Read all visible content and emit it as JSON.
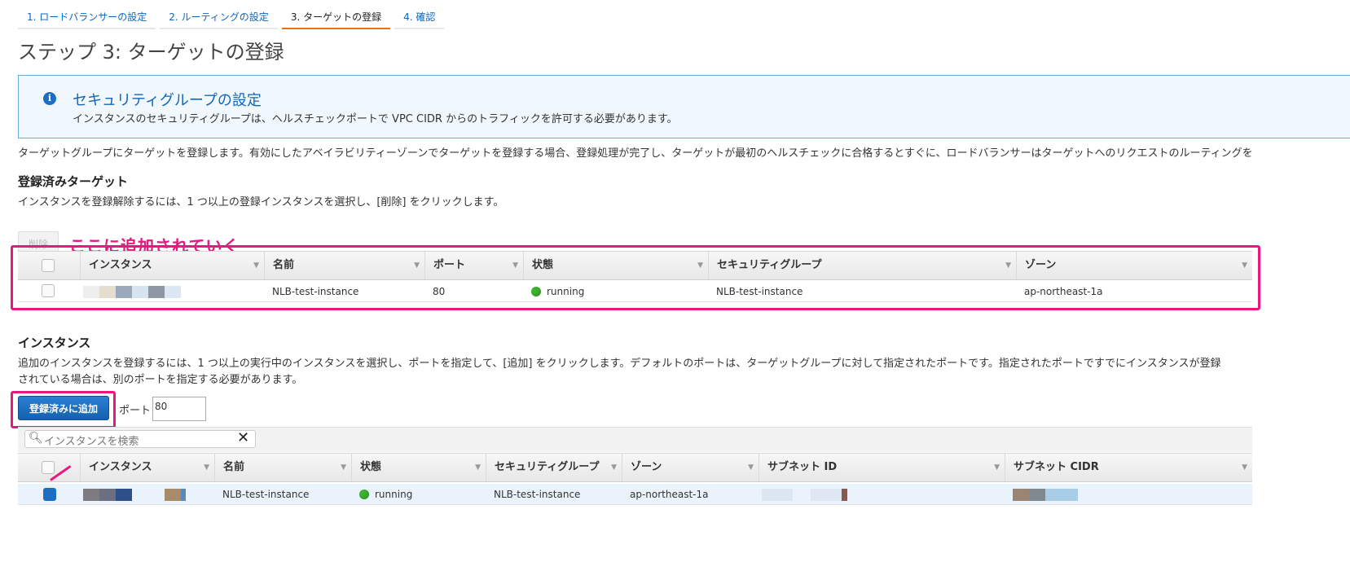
{
  "tabs": [
    {
      "label": "1. ロードバランサーの設定"
    },
    {
      "label": "2. ルーティングの設定"
    },
    {
      "label": "3. ターゲットの登録"
    },
    {
      "label": "4. 確認"
    }
  ],
  "page_title": "ステップ 3: ターゲットの登録",
  "info": {
    "icon": "info-icon",
    "icon_glyph": "i",
    "title": "セキュリティグループの設定",
    "text": "インスタンスのセキュリティグループは、ヘルスチェックポートで VPC CIDR からのトラフィックを許可する必要があります。"
  },
  "intro": "ターゲットグループにターゲットを登録します。有効にしたアベイラビリティーゾーンでターゲットを登録する場合、登録処理が完了し、ターゲットが最初のヘルスチェックに合格するとすぐに、ロードバランサーはターゲットへのリクエストのルーティングを",
  "registered": {
    "heading": "登録済みターゲット",
    "desc": "インスタンスを登録解除するには、1 つ以上の登録インスタンスを選択し、[削除] をクリックします。",
    "remove_label": "削除",
    "annotation": "ここに追加されていく",
    "columns": [
      "インスタンス",
      "名前",
      "ポート",
      "状態",
      "セキュリティグループ",
      "ゾーン"
    ],
    "rows": [
      {
        "name": "NLB-test-instance",
        "port": "80",
        "state": "running",
        "sg": "NLB-test-instance",
        "zone": "ap-northeast-1a"
      }
    ]
  },
  "instances": {
    "heading": "インスタンス",
    "desc_line1": "追加のインスタンスを登録するには、1 つ以上の実行中のインスタンスを選択し、ポートを指定して、[追加] をクリックします。デフォルトのポートは、ターゲットグループに対して指定されたポートです。指定されたポートですでにインスタンスが登録",
    "desc_line2": "されている場合は、別のポートを指定する必要があります。",
    "add_label": "登録済みに追加",
    "port_label": "ポート",
    "port_value": "80",
    "search_placeholder": "インスタンスを検索",
    "columns": [
      "インスタンス",
      "名前",
      "状態",
      "セキュリティグループ",
      "ゾーン",
      "サブネット ID",
      "サブネット CIDR"
    ],
    "rows": [
      {
        "name": "NLB-test-instance",
        "state": "running",
        "sg": "NLB-test-instance",
        "zone": "ap-northeast-1a",
        "selected": true
      }
    ]
  },
  "colors": {
    "accent": "#1166bb",
    "annotation": "#e8187f",
    "active_tab": "#ec7211",
    "running": "#3cb32e"
  }
}
